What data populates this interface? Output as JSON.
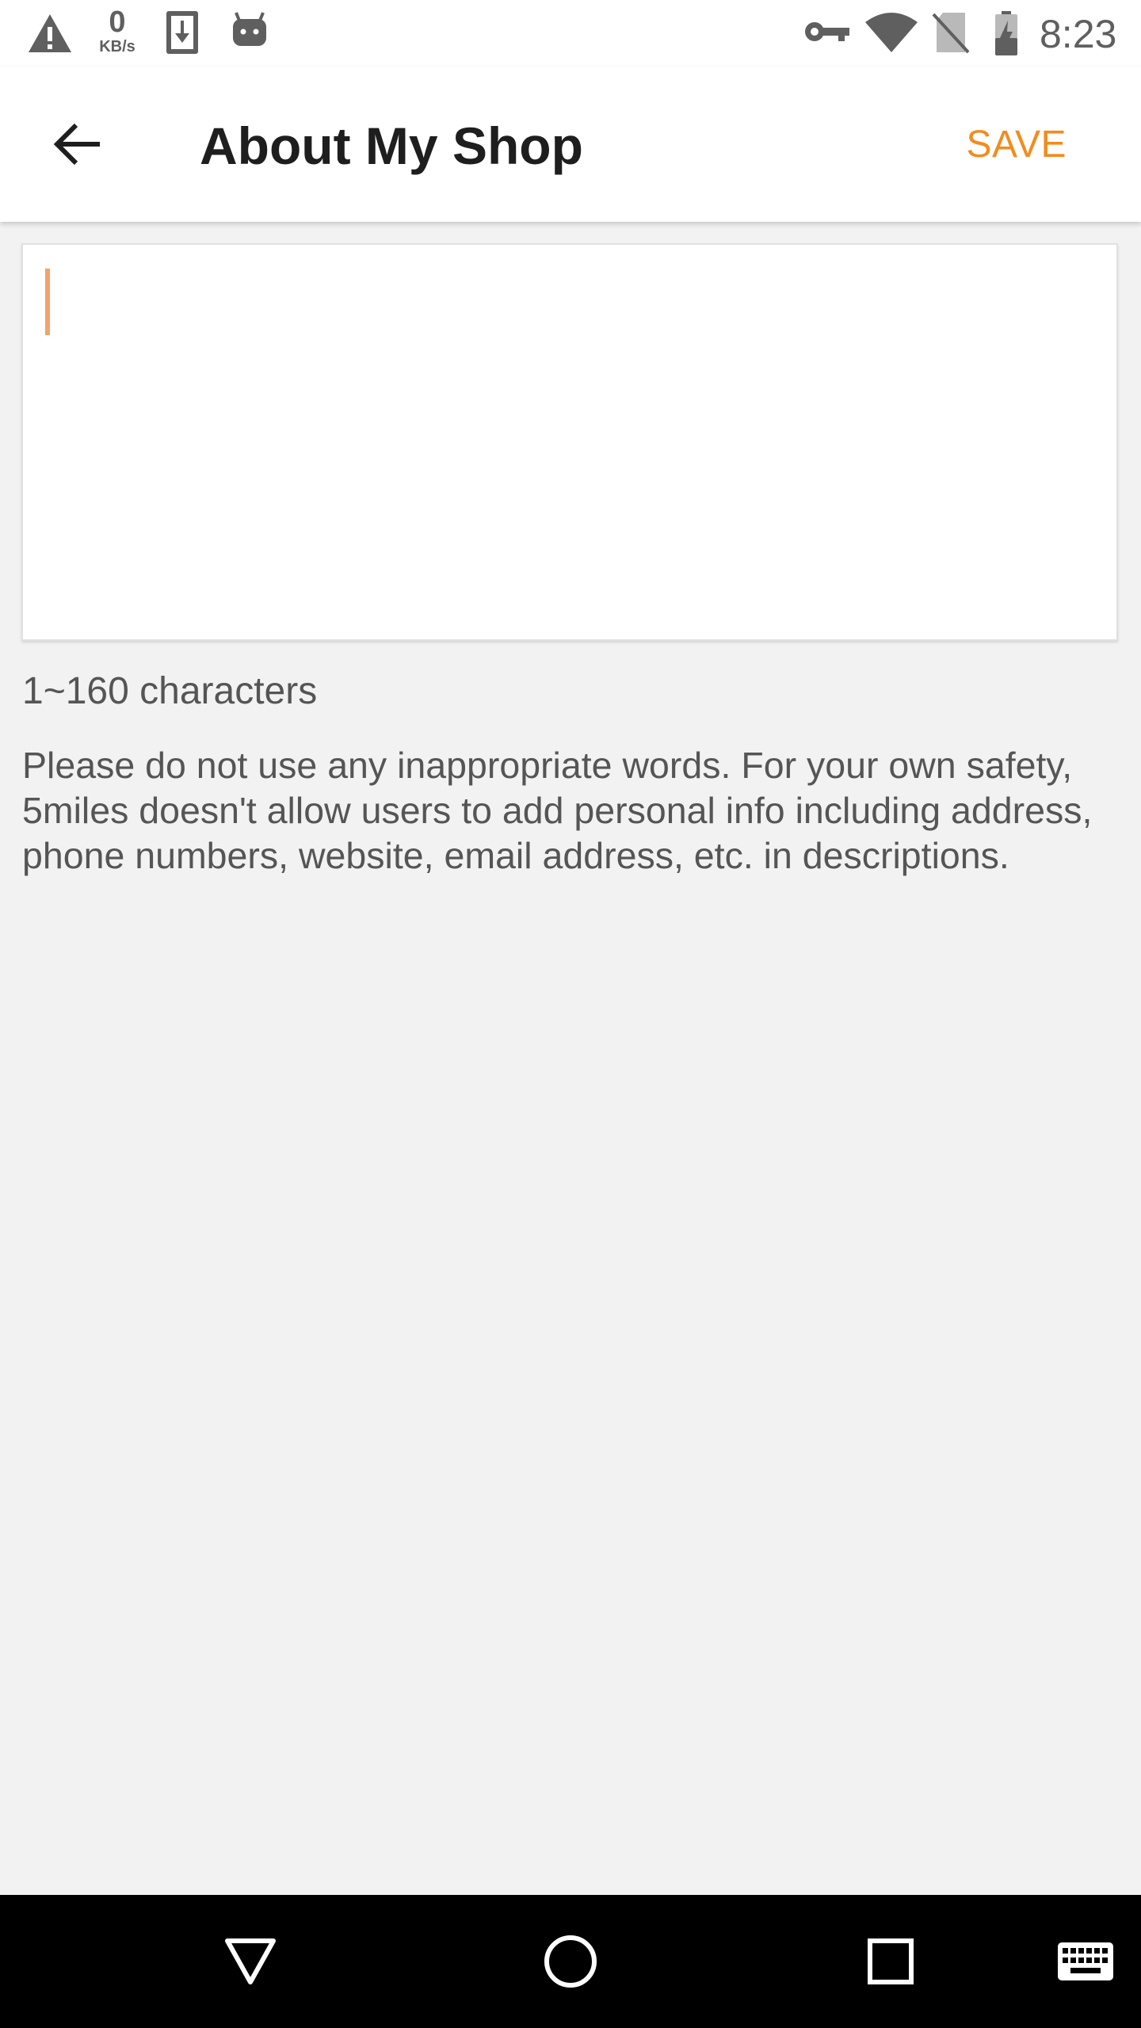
{
  "status_bar": {
    "net_speed_value": "0",
    "net_speed_unit": "KB/s",
    "time": "8:23",
    "left_icons": [
      "warning-icon",
      "network-speed",
      "download-icon",
      "android-icon"
    ],
    "right_icons": [
      "vpn-key-icon",
      "wifi-icon",
      "no-sim-icon",
      "battery-charging-icon"
    ]
  },
  "app_bar": {
    "title": "About My Shop",
    "save_label": "SAVE",
    "accent_color": "#f28c1e"
  },
  "editor": {
    "value": "",
    "caret_color": "#f2a26b"
  },
  "hints": {
    "char_limit": "1~160 characters",
    "notice": "Please do not use any inappropriate words. For your own safety, 5miles doesn't allow users to add personal info including address, phone numbers, website, email address, etc. in descriptions."
  },
  "nav_bar": {
    "buttons": [
      "back-triangle-icon",
      "home-circle-icon",
      "recents-square-icon",
      "keyboard-icon"
    ]
  }
}
